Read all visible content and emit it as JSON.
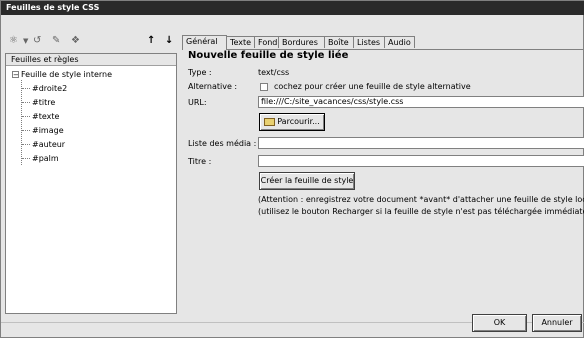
{
  "window": {
    "title": "Feuilles de style CSS"
  },
  "toolbar": {
    "icons": [
      "add-sheet-icon",
      "dropdown-icon",
      "link-icon",
      "edit-icon",
      "delete-icon",
      "move-up-icon",
      "move-down-icon"
    ],
    "up_label": "↑",
    "down_label": "↓"
  },
  "left_panel": {
    "header": "Feuilles et règles",
    "root": {
      "toggle": "−",
      "label": "Feuille de style interne"
    },
    "items": [
      "#droite2",
      "#titre",
      "#texte",
      "#image",
      "#auteur",
      "#palm"
    ]
  },
  "tabs": [
    "Général",
    "Texte",
    "Fond",
    "Bordures",
    "Boîte",
    "Listes",
    "Audio"
  ],
  "active_tab": "Général",
  "form": {
    "heading": "Nouvelle feuille de style liée",
    "type_label": "Type :",
    "type_value": "text/css",
    "alternative_label": "Alternative :",
    "alternative_checkbox_label": "cochez pour créer une feuille de style alternative",
    "alternative_checked": false,
    "url_label": "URL:",
    "url_value": "file:///C:/site_vacances/css/style.css",
    "browse_label": "Parcourir...",
    "media_label": "Liste des média :",
    "media_value": "",
    "title_label": "Titre :",
    "title_value": "",
    "create_label": "Créer la feuille de style",
    "note1": "(Attention : enregistrez votre document *avant* d'attacher une feuille de style locale)",
    "note2": "(utilisez le bouton Recharger si la feuille de style n'est pas téléchargée immédiatement)"
  },
  "footer": {
    "ok_label": "OK",
    "cancel_label": "Annuler"
  }
}
